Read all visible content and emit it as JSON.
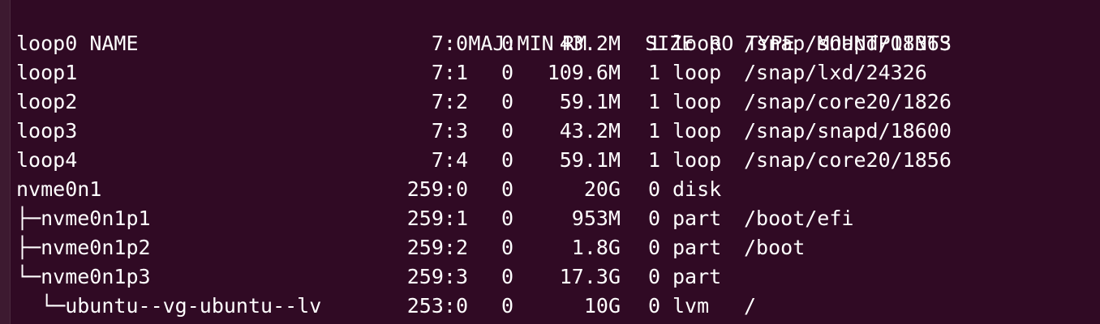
{
  "terminal": {
    "header": {
      "name": "NAME",
      "majmin": "MAJ:MIN",
      "rm": "RM",
      "size": "SIZE",
      "ro": "RO",
      "type": "TYPE",
      "mountpoints": "MOUNTPOINTS"
    },
    "rows": [
      {
        "name": "loop0",
        "majmin": "7:0",
        "rm": "0",
        "size": "43.2M",
        "ro": "1",
        "type": "loop",
        "mountpoints": "/snap/snapd/18363"
      },
      {
        "name": "loop1",
        "majmin": "7:1",
        "rm": "0",
        "size": "109.6M",
        "ro": "1",
        "type": "loop",
        "mountpoints": "/snap/lxd/24326"
      },
      {
        "name": "loop2",
        "majmin": "7:2",
        "rm": "0",
        "size": "59.1M",
        "ro": "1",
        "type": "loop",
        "mountpoints": "/snap/core20/1826"
      },
      {
        "name": "loop3",
        "majmin": "7:3",
        "rm": "0",
        "size": "43.2M",
        "ro": "1",
        "type": "loop",
        "mountpoints": "/snap/snapd/18600"
      },
      {
        "name": "loop4",
        "majmin": "7:4",
        "rm": "0",
        "size": "59.1M",
        "ro": "1",
        "type": "loop",
        "mountpoints": "/snap/core20/1856"
      },
      {
        "name": "nvme0n1",
        "majmin": "259:0",
        "rm": "0",
        "size": "20G",
        "ro": "0",
        "type": "disk",
        "mountpoints": ""
      },
      {
        "name": "├─nvme0n1p1",
        "majmin": "259:1",
        "rm": "0",
        "size": "953M",
        "ro": "0",
        "type": "part",
        "mountpoints": "/boot/efi"
      },
      {
        "name": "├─nvme0n1p2",
        "majmin": "259:2",
        "rm": "0",
        "size": "1.8G",
        "ro": "0",
        "type": "part",
        "mountpoints": "/boot"
      },
      {
        "name": "└─nvme0n1p3",
        "majmin": "259:3",
        "rm": "0",
        "size": "17.3G",
        "ro": "0",
        "type": "part",
        "mountpoints": ""
      },
      {
        "name": "  └─ubuntu--vg-ubuntu--lv",
        "majmin": "253:0",
        "rm": "0",
        "size": "10G",
        "ro": "0",
        "type": "lvm",
        "mountpoints": "/"
      }
    ]
  }
}
